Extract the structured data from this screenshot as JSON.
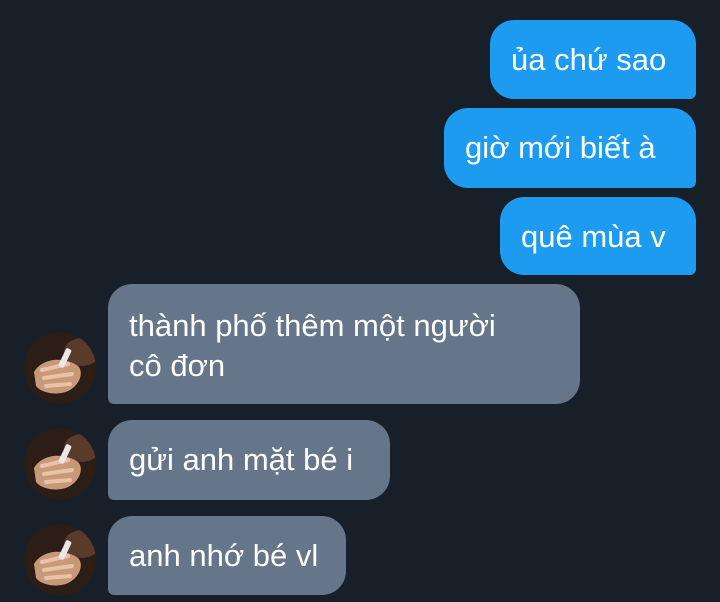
{
  "conversation": {
    "outgoing": [
      {
        "text": "ủa chứ sao"
      },
      {
        "text": "giờ mới biết à"
      },
      {
        "text": "quê mùa v"
      }
    ],
    "incoming": [
      {
        "lines": [
          "thành phố thêm một người",
          "cô đơn"
        ]
      },
      {
        "text": "gửi anh mặt bé i"
      },
      {
        "text": "anh nhớ bé vl"
      }
    ]
  },
  "colors": {
    "background": "#172029",
    "outgoing_bubble": "#1d9bf0",
    "incoming_bubble": "#66768a",
    "text": "#ffffff"
  },
  "icons": {
    "sender_avatar": "avatar-hand-photo"
  }
}
